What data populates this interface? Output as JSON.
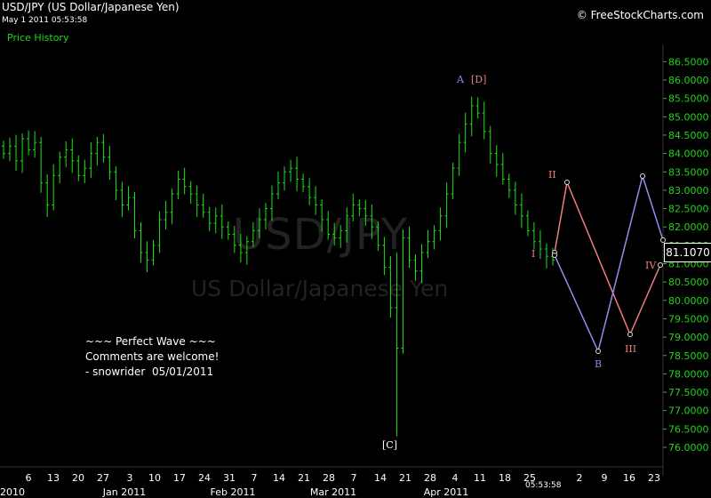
{
  "header": {
    "title": "USD/JPY (US Dollar/Japanese Yen)",
    "timestamp": "May 1 2011 05:53:58",
    "copyright": "© FreeStockCharts.com",
    "panel_label": "Price History"
  },
  "watermark": {
    "symbol": "USD/JPY",
    "name": "US Dollar/Japanese Yen"
  },
  "note": "~~~ Perfect Wave ~~~\nComments are welcome!\n- snowrider  05/01/2011",
  "price_tag": "81.1070",
  "bottom_time": "05:53:58",
  "colors": {
    "up": "#1fe01a",
    "axis": "#22d418",
    "bg": "#000000",
    "red_path": "#f07d7d",
    "blue_path": "#8e8ef0"
  },
  "chart_data": {
    "type": "candlestick",
    "title": "USD/JPY (US Dollar/Japanese Yen)",
    "ylim": [
      75.7,
      86.75
    ],
    "yticks": [
      "76.0000",
      "76.5000",
      "77.0000",
      "77.5000",
      "78.0000",
      "78.5000",
      "79.0000",
      "79.5000",
      "80.0000",
      "80.5000",
      "81.0000",
      "81.5000",
      "82.0000",
      "82.5000",
      "83.0000",
      "83.5000",
      "84.0000",
      "84.5000",
      "85.0000",
      "85.5000",
      "86.0000",
      "86.5000"
    ],
    "xticks": [
      "6",
      "13",
      "20",
      "27",
      "3",
      "10",
      "17",
      "24",
      "31",
      "7",
      "14",
      "21",
      "28",
      "7",
      "14",
      "21",
      "28",
      "4",
      "11",
      "18",
      "25",
      "2",
      "9",
      "16",
      "23"
    ],
    "xperiod_labels": [
      "Jan 2011",
      "Feb 2011",
      "Mar 2011",
      "Apr 2011"
    ],
    "xperiod_corner": "2010",
    "series_close": [
      84.0,
      84.2,
      83.8,
      84.4,
      84.1,
      84.3,
      83.2,
      82.6,
      83.4,
      83.9,
      84.1,
      83.8,
      83.4,
      83.6,
      84.0,
      84.3,
      83.9,
      83.5,
      83.0,
      82.6,
      82.8,
      81.9,
      81.3,
      81.1,
      81.5,
      82.2,
      82.4,
      82.9,
      83.3,
      83.1,
      82.9,
      82.6,
      82.4,
      82.1,
      82.3,
      82.0,
      81.8,
      81.5,
      81.3,
      81.6,
      81.9,
      82.2,
      82.5,
      82.9,
      83.2,
      83.5,
      83.6,
      83.3,
      83.1,
      82.8,
      82.6,
      82.2,
      81.8,
      81.7,
      81.9,
      82.3,
      82.6,
      82.5,
      82.3,
      82.0,
      81.5,
      80.9,
      79.8,
      78.7,
      81.7,
      81.1,
      80.8,
      81.3,
      81.6,
      81.9,
      82.3,
      82.9,
      83.6,
      84.3,
      84.8,
      85.3,
      85.1,
      84.6,
      84.0,
      83.7,
      83.3,
      83.0,
      82.6,
      82.3,
      81.9,
      81.6,
      81.4,
      81.2,
      81.1
    ],
    "notable_points": {
      "A": 85.5,
      "C_low": 76.3
    },
    "projection": {
      "red": {
        "points": [
          [
            "I",
            81.1
          ],
          [
            "II",
            82.9
          ],
          [
            "III",
            78.9
          ],
          [
            "IV",
            80.7
          ]
        ]
      },
      "blue": {
        "points": [
          [
            "I",
            81.0
          ],
          [
            "B",
            78.5
          ],
          [
            "end",
            83.1
          ],
          [
            "right",
            81.1
          ]
        ]
      }
    },
    "labels": [
      "A",
      "[D]",
      "[C]",
      "I",
      "II",
      "III",
      "IV",
      "B"
    ],
    "grid": false
  }
}
